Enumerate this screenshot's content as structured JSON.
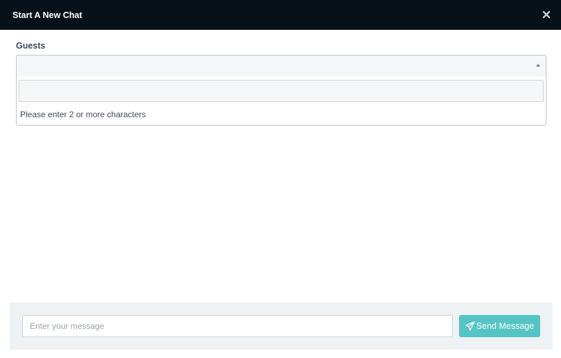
{
  "modal": {
    "title": "Start A New Chat",
    "close_icon": "close-icon"
  },
  "guests": {
    "label": "Guests",
    "selected_value": "",
    "search_value": "",
    "message": "Please enter 2 or more characters"
  },
  "composer": {
    "placeholder": "Enter your message",
    "value": "",
    "send_label": "Send Message",
    "send_icon": "paper-plane-icon"
  },
  "colors": {
    "header_bg": "#07111a",
    "accent": "#55c4c4",
    "composer_bg": "#eff2f5"
  }
}
